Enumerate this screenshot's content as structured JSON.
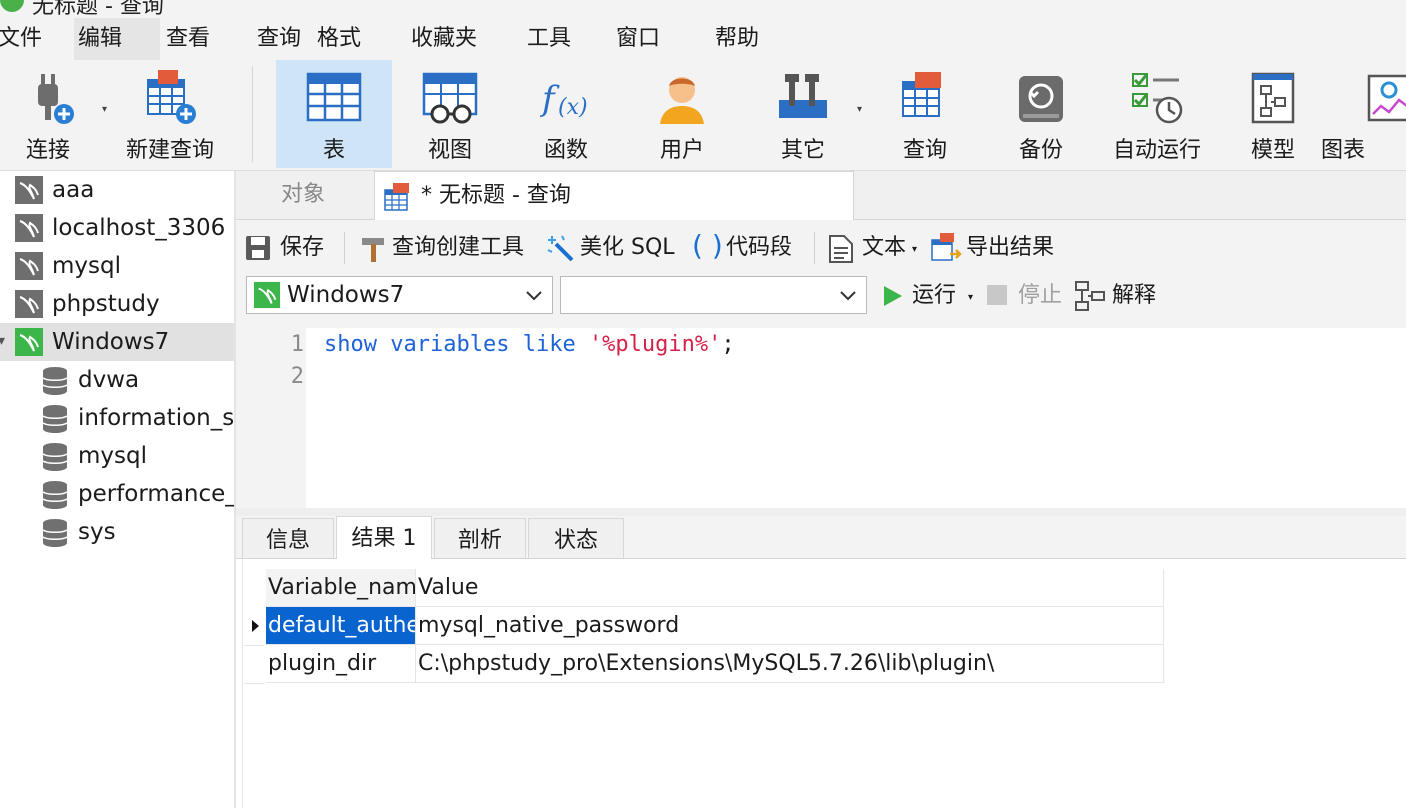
{
  "window": {
    "title": "无标题 - 查询"
  },
  "menu": [
    "文件",
    "编辑",
    "查看",
    "查询",
    "格式",
    "收藏夹",
    "工具",
    "窗口",
    "帮助"
  ],
  "toolbar": {
    "connect": "连接",
    "new_query": "新建查询",
    "table": "表",
    "view": "视图",
    "function": "函数",
    "user": "用户",
    "other": "其它",
    "query": "查询",
    "backup": "备份",
    "automation": "自动运行",
    "model": "模型",
    "chart": "图表"
  },
  "tree": {
    "connections": [
      "aaa",
      "localhost_3306",
      "mysql",
      "phpstudy",
      "Windows7"
    ],
    "databases": [
      "dvwa",
      "information_s",
      "mysql",
      "performance_",
      "sys"
    ]
  },
  "tabs": {
    "objects": "对象",
    "query": "* 无标题 - 查询"
  },
  "query_toolbar": {
    "save": "保存",
    "query_builder": "查询创建工具",
    "beautify": "美化 SQL",
    "snippet": "代码段",
    "text": "文本",
    "export": "导出结果",
    "connection_value": "Windows7",
    "database_value": "",
    "run": "运行",
    "stop": "停止",
    "explain": "解释"
  },
  "editor": {
    "line_numbers": [
      "1",
      "2"
    ],
    "kw1": "show",
    "kw2": "variables",
    "kw3": "like",
    "str": "'%plugin%'",
    "end": ";"
  },
  "result_tabs": [
    "信息",
    "结果 1",
    "剖析",
    "状态"
  ],
  "grid": {
    "columns": [
      "Variable_nam",
      "Value"
    ],
    "rows": [
      [
        "default_authe",
        "mysql_native_password"
      ],
      [
        "plugin_dir",
        "C:\\phpstudy_pro\\Extensions\\MySQL5.7.26\\lib\\plugin\\"
      ]
    ]
  }
}
